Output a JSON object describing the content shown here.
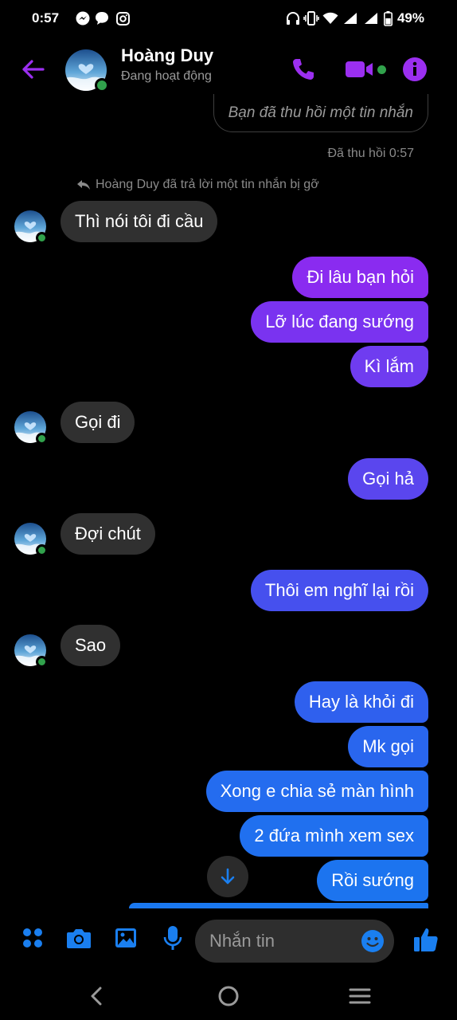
{
  "status": {
    "time": "0:57",
    "battery": "49%"
  },
  "header": {
    "contact_name": "Hoàng Duy",
    "status_text": "Đang hoạt động"
  },
  "recalled": {
    "pill_text": "Bạn đã thu hồi một tin nhắn",
    "time_text": "Đã thu hồi 0:57"
  },
  "reply_note": "Hoàng Duy đã trả lời một tin nhắn bị gỡ",
  "messages": [
    {
      "side": "in",
      "text": "Thì nói tôi đi cầu"
    },
    {
      "side": "out",
      "text": "Đi lâu bạn hỏi"
    },
    {
      "side": "out",
      "text": "Lỡ lúc đang sướng"
    },
    {
      "side": "out",
      "text": "Kì lắm"
    },
    {
      "side": "in",
      "text": "Gọi đi"
    },
    {
      "side": "out",
      "text": "Gọi hả"
    },
    {
      "side": "in",
      "text": "Đợi chút"
    },
    {
      "side": "out",
      "text": "Thôi em nghĩ lại rồi"
    },
    {
      "side": "in",
      "text": "Sao"
    },
    {
      "side": "out",
      "text": "Hay là khỏi đi"
    },
    {
      "side": "out",
      "text": "Mk gọi"
    },
    {
      "side": "out",
      "text": "Xong e chia sẻ màn hình"
    },
    {
      "side": "out",
      "text": "2 đứa mình xem sex"
    },
    {
      "side": "out",
      "text": "Rồi sướng"
    }
  ],
  "composer": {
    "placeholder": "Nhắn tin"
  },
  "colors": {
    "accent_purple": "#9b2ff0",
    "accent_blue": "#1a7ff0",
    "online": "#31a24c"
  }
}
